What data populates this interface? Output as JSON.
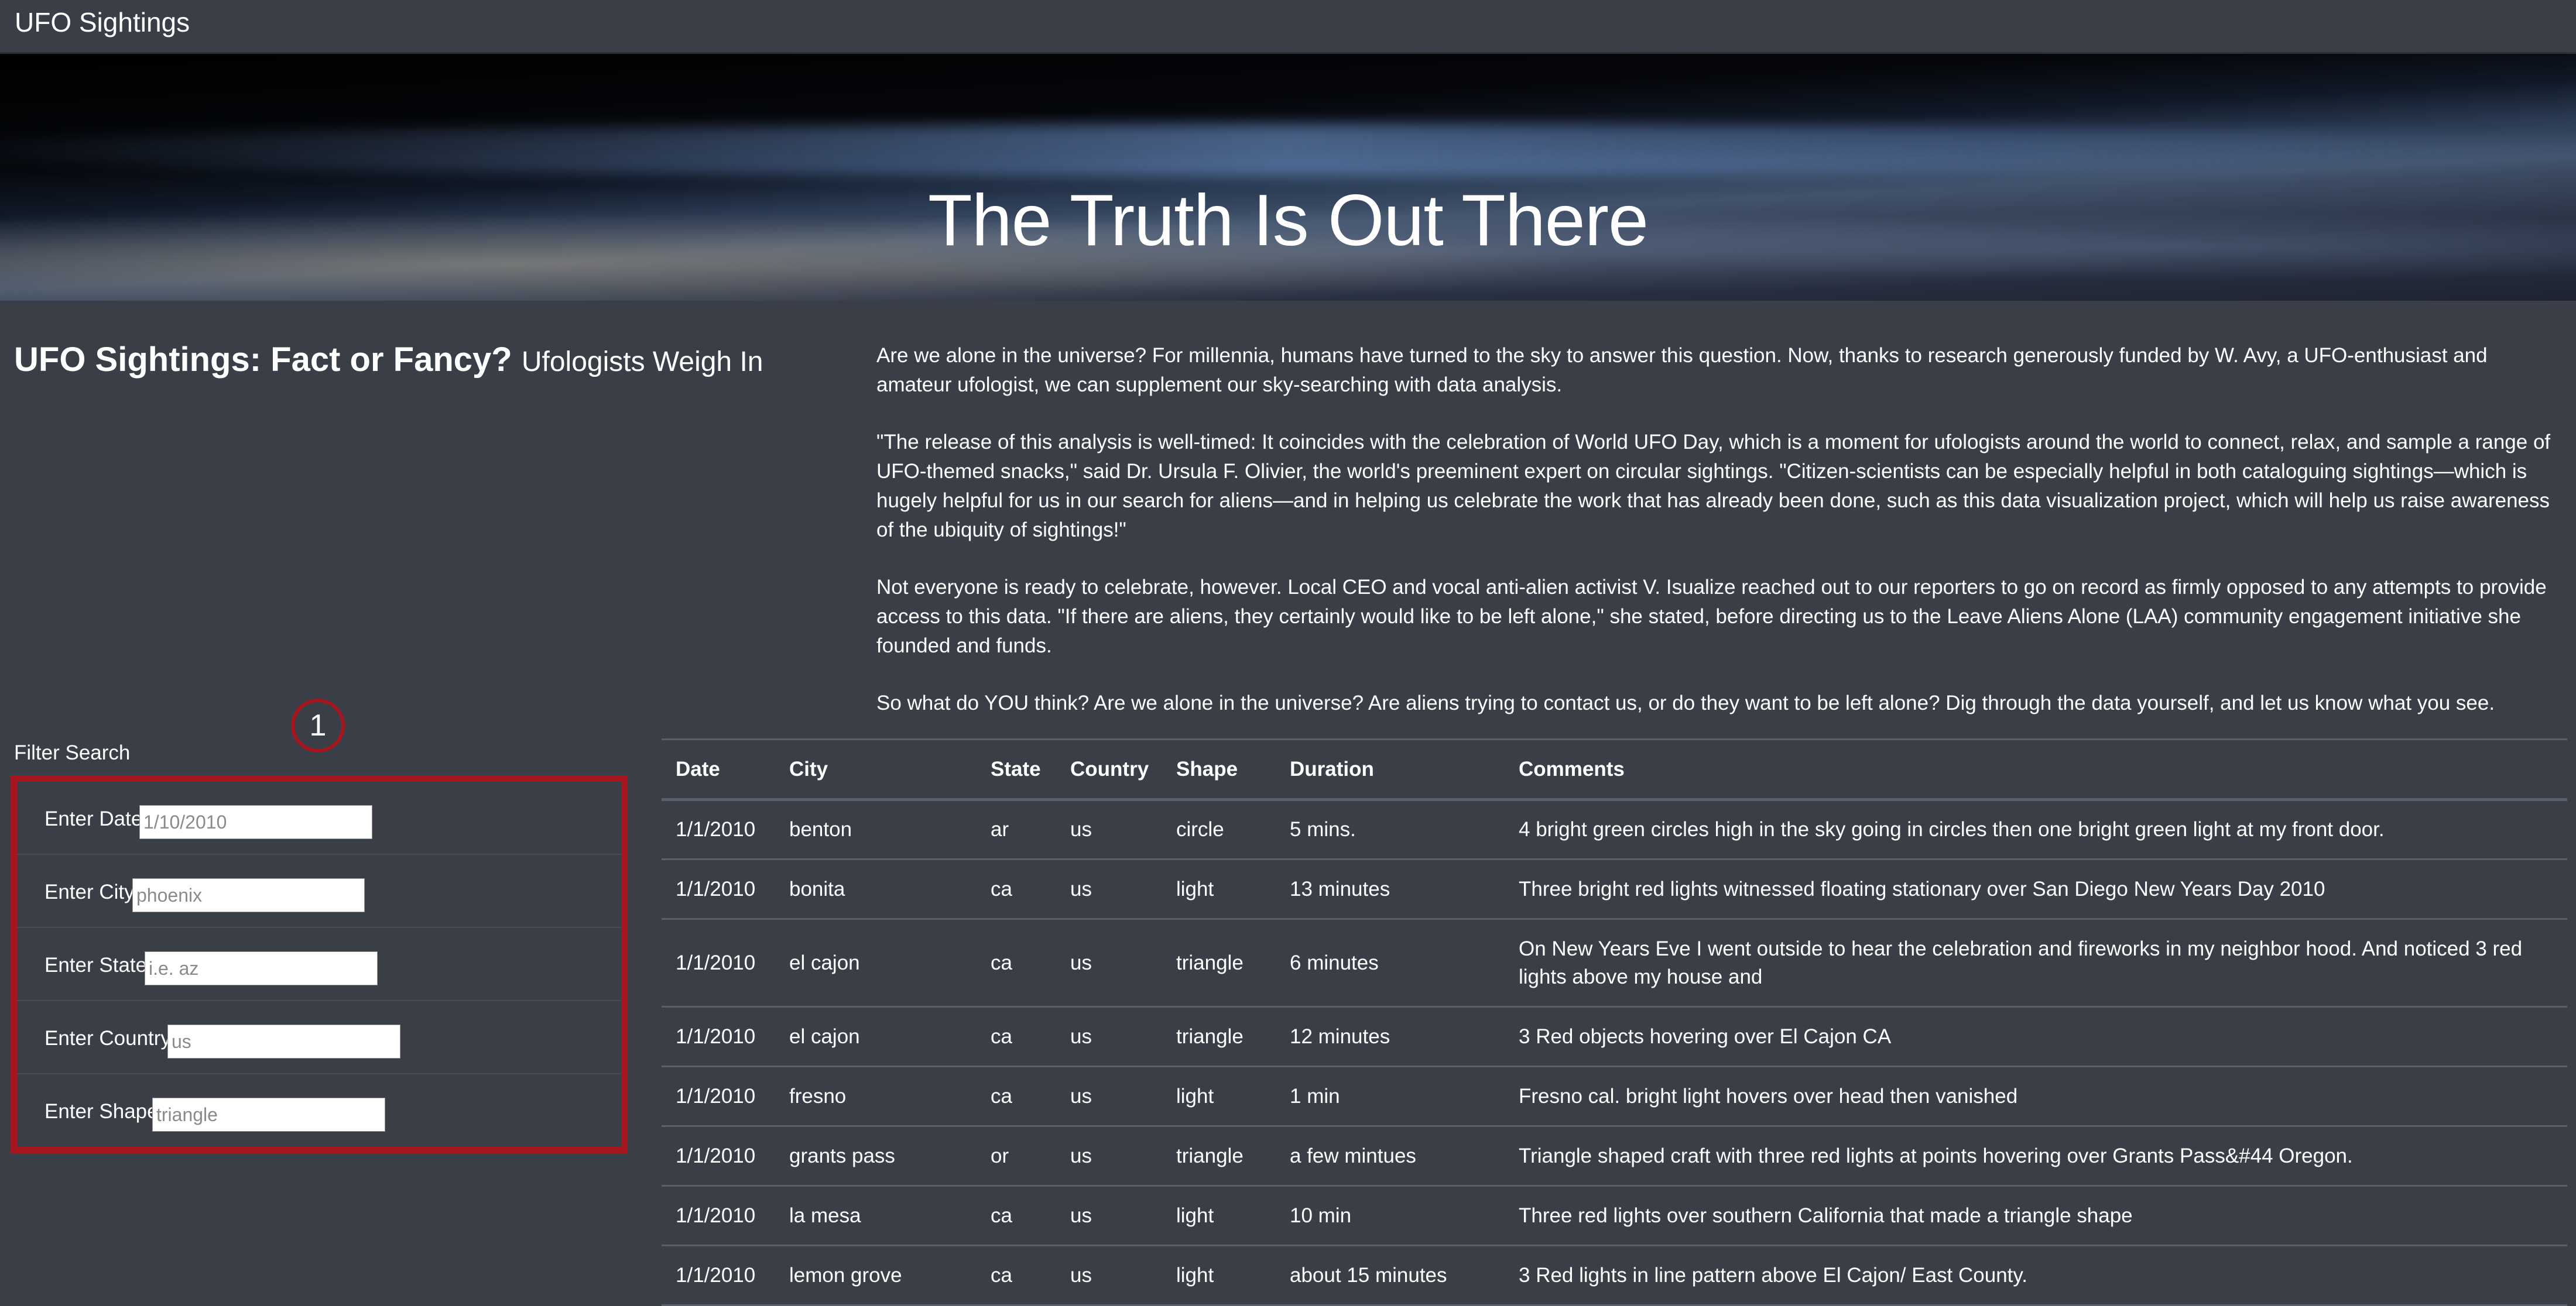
{
  "navbar": {
    "brand": "UFO Sightings"
  },
  "hero": {
    "title": "The Truth Is Out There"
  },
  "heading": {
    "main": "UFO Sightings: Fact or Fancy?",
    "sub": "Ufologists Weigh In"
  },
  "article": {
    "paragraphs": [
      "Are we alone in the universe? For millennia, humans have turned to the sky to answer this question. Now, thanks to research generously funded by W. Avy, a UFO-enthusiast and amateur ufologist, we can supplement our sky-searching with data analysis.",
      "\"The release of this analysis is well-timed: It coincides with the celebration of World UFO Day, which is a moment for ufologists around the world to connect, relax, and sample a range of UFO-themed snacks,\" said Dr. Ursula F. Olivier, the world's preeminent expert on circular sightings. \"Citizen-scientists can be especially helpful in both cataloguing sightings—which is hugely helpful for us in our search for aliens—and in helping us celebrate the work that has already been done, such as this data visualization project, which will help us raise awareness of the ubiquity of sightings!\"",
      "Not everyone is ready to celebrate, however. Local CEO and vocal anti-alien activist V. Isualize reached out to our reporters to go on record as firmly opposed to any attempts to provide access to this data. \"If there are aliens, they certainly would like to be left alone,\" she stated, before directing us to the Leave Aliens Alone (LAA) community engagement initiative she founded and funds.",
      "So what do YOU think? Are we alone in the universe? Are aliens trying to contact us, or do they want to be left alone? Dig through the data yourself, and let us know what you see."
    ]
  },
  "annotation": {
    "marker": "1",
    "color": "#a7161e"
  },
  "filter": {
    "title": "Filter Search",
    "fields": [
      {
        "label": "Enter Date",
        "placeholder": "1/10/2010"
      },
      {
        "label": "Enter City",
        "placeholder": "phoenix"
      },
      {
        "label": "Enter State",
        "placeholder": "i.e. az"
      },
      {
        "label": "Enter Country",
        "placeholder": "us"
      },
      {
        "label": "Enter Shape",
        "placeholder": "triangle"
      }
    ]
  },
  "table": {
    "headers": [
      "Date",
      "City",
      "State",
      "Country",
      "Shape",
      "Duration",
      "Comments"
    ],
    "rows": [
      [
        "1/1/2010",
        "benton",
        "ar",
        "us",
        "circle",
        "5 mins.",
        "4 bright green circles high in the sky going in circles then one bright green light at my front door."
      ],
      [
        "1/1/2010",
        "bonita",
        "ca",
        "us",
        "light",
        "13 minutes",
        "Three bright red lights witnessed floating stationary over San Diego New Years Day 2010"
      ],
      [
        "1/1/2010",
        "el cajon",
        "ca",
        "us",
        "triangle",
        "6 minutes",
        "On New Years Eve I went outside to hear the celebration and fireworks in my neighbor hood. And noticed 3 red lights above my house and"
      ],
      [
        "1/1/2010",
        "el cajon",
        "ca",
        "us",
        "triangle",
        "12 minutes",
        "3 Red objects hovering over El Cajon CA"
      ],
      [
        "1/1/2010",
        "fresno",
        "ca",
        "us",
        "light",
        "1 min",
        "Fresno cal. bright light hovers over head then vanished"
      ],
      [
        "1/1/2010",
        "grants pass",
        "or",
        "us",
        "triangle",
        "a few mintues",
        "Triangle shaped craft with three red lights at points hovering over Grants Pass&#44 Oregon."
      ],
      [
        "1/1/2010",
        "la mesa",
        "ca",
        "us",
        "light",
        "10 min",
        "Three red lights over southern California that made a triangle shape"
      ],
      [
        "1/1/2010",
        "lemon grove",
        "ca",
        "us",
        "light",
        "about 15 minutes",
        "3 Red lights in line pattern above El Cajon/ East County."
      ]
    ]
  }
}
